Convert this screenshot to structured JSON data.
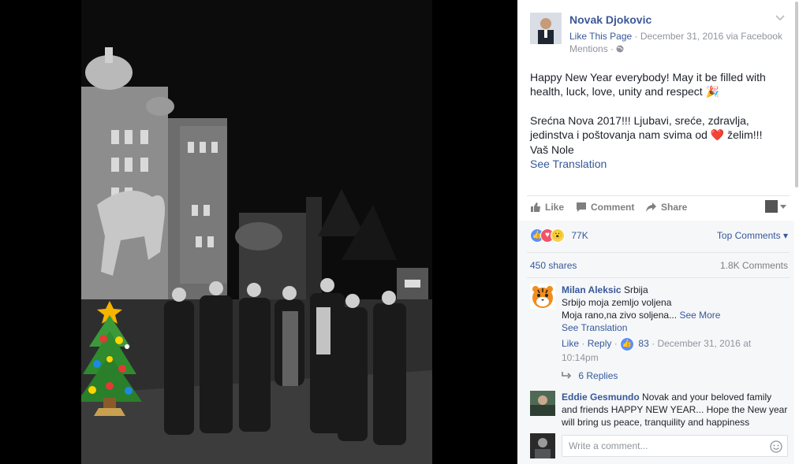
{
  "post": {
    "page_name": "Novak Djokovic",
    "like_page": "Like This Page",
    "date_line": "· December 31, 2016 via Facebook",
    "mentions": "Mentions ·",
    "text_en": "Happy New Year everybody! May it be filled with health, luck, love, unity and respect 🎉",
    "text_sr_1": "Srećna Nova 2017!!! Ljubavi, sreće, zdravlja, jedinstva i poštovanja nam svima od",
    "text_sr_2": "želim!!! Vaš Nole",
    "see_translation": "See Translation",
    "heart_emoji": "❤️"
  },
  "actions": {
    "like": "Like",
    "comment": "Comment",
    "share": "Share"
  },
  "stats": {
    "reaction_count": "77K",
    "top_comments": "Top Comments",
    "shares": "450 shares",
    "comments": "1.8K Comments"
  },
  "comments": [
    {
      "name": "Milan Aleksic",
      "text_1": "Srbija",
      "text_2": "Srbijo moja zemljo voljena",
      "text_3": "Moja rano,na zivo soljena...",
      "see_more": "See More",
      "see_translation": "See Translation",
      "like": "Like",
      "reply": "Reply",
      "likes": "83",
      "time": "· December 31, 2016 at 10:14pm",
      "replies": "6 Replies"
    },
    {
      "name": "Eddie Gesmundo",
      "text": "Novak and your beloved family and friends HAPPY NEW YEAR... Hope the New year will bring us peace, tranquility and happiness"
    }
  ],
  "composer": {
    "placeholder": "Write a comment..."
  },
  "icons": [
    "chevron-down-icon",
    "globe-icon",
    "like-thumb-icon",
    "comment-bubble-icon",
    "share-arrow-icon",
    "reply-arrow-icon",
    "smiley-icon"
  ]
}
